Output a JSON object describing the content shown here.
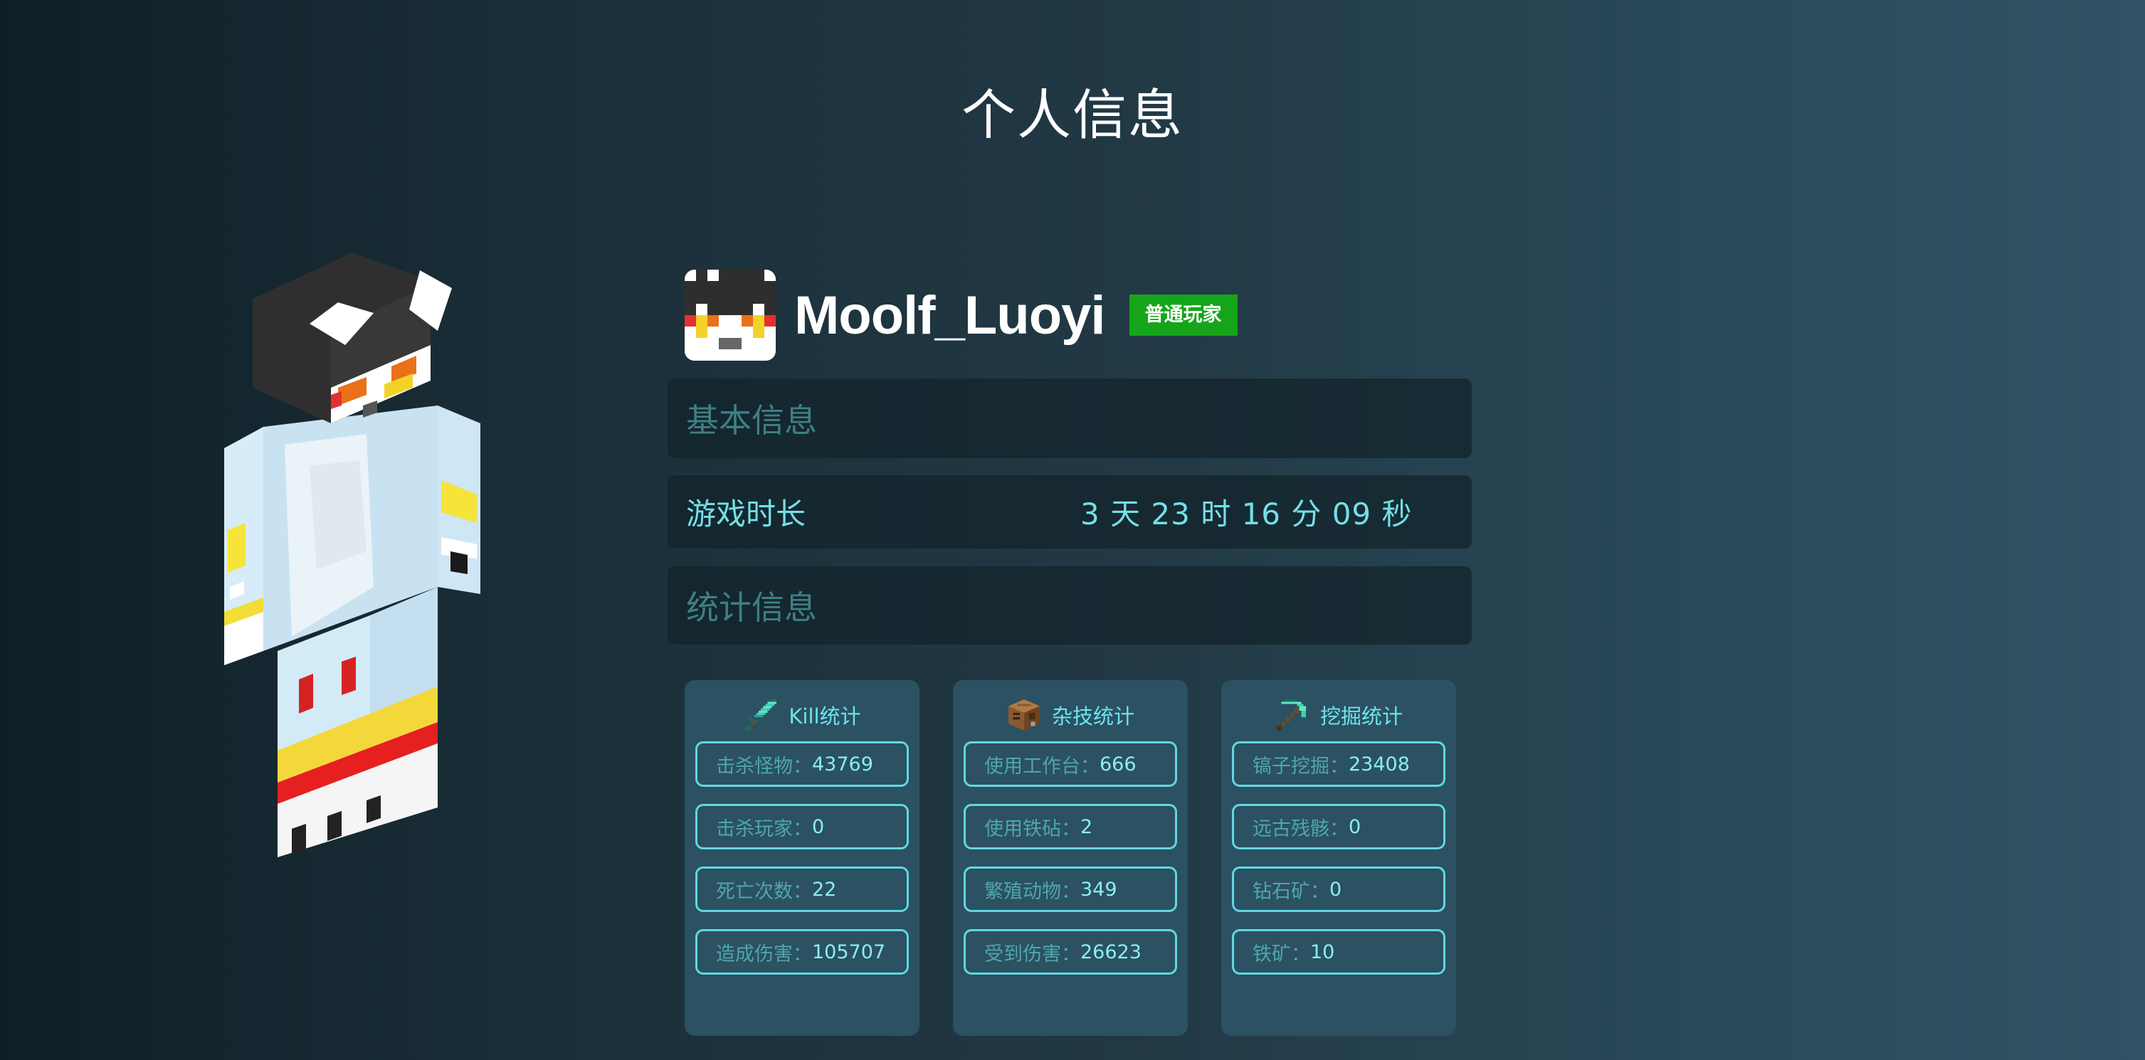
{
  "page": {
    "title": "个人信息"
  },
  "profile": {
    "player_name": "Moolf_Luoyi",
    "rank": "普通玩家"
  },
  "sections": {
    "basic_info": "基本信息",
    "statistics": "统计信息"
  },
  "playtime": {
    "label": "游戏时长",
    "value": "3 天 23 时 16 分 09 秒"
  },
  "cards": {
    "kill": {
      "icon": "diamond-sword-icon",
      "title": "Kill统计",
      "stats": [
        {
          "label": "击杀怪物：",
          "value": "43769"
        },
        {
          "label": "击杀玩家：",
          "value": "0"
        },
        {
          "label": "死亡次数：",
          "value": "22"
        },
        {
          "label": "造成伤害：",
          "value": "105707"
        }
      ]
    },
    "misc": {
      "icon": "crafting-table-icon",
      "title": "杂技统计",
      "stats": [
        {
          "label": "使用工作台：",
          "value": "666"
        },
        {
          "label": "使用铁砧：",
          "value": "2"
        },
        {
          "label": "繁殖动物：",
          "value": "349"
        },
        {
          "label": "受到伤害：",
          "value": "26623"
        }
      ]
    },
    "dig": {
      "icon": "diamond-pickaxe-icon",
      "title": "挖掘统计",
      "stats": [
        {
          "label": "镐子挖掘：",
          "value": "23408"
        },
        {
          "label": "远古残骸：",
          "value": "0"
        },
        {
          "label": "钻石矿：",
          "value": "0"
        },
        {
          "label": "铁矿：",
          "value": "10"
        }
      ]
    }
  },
  "colors": {
    "accent": "#6ee3ec",
    "badge": "#16a51a",
    "card_bg": "#2b5162",
    "section_bg": "#12222a",
    "heading_muted": "#3e7f86"
  }
}
